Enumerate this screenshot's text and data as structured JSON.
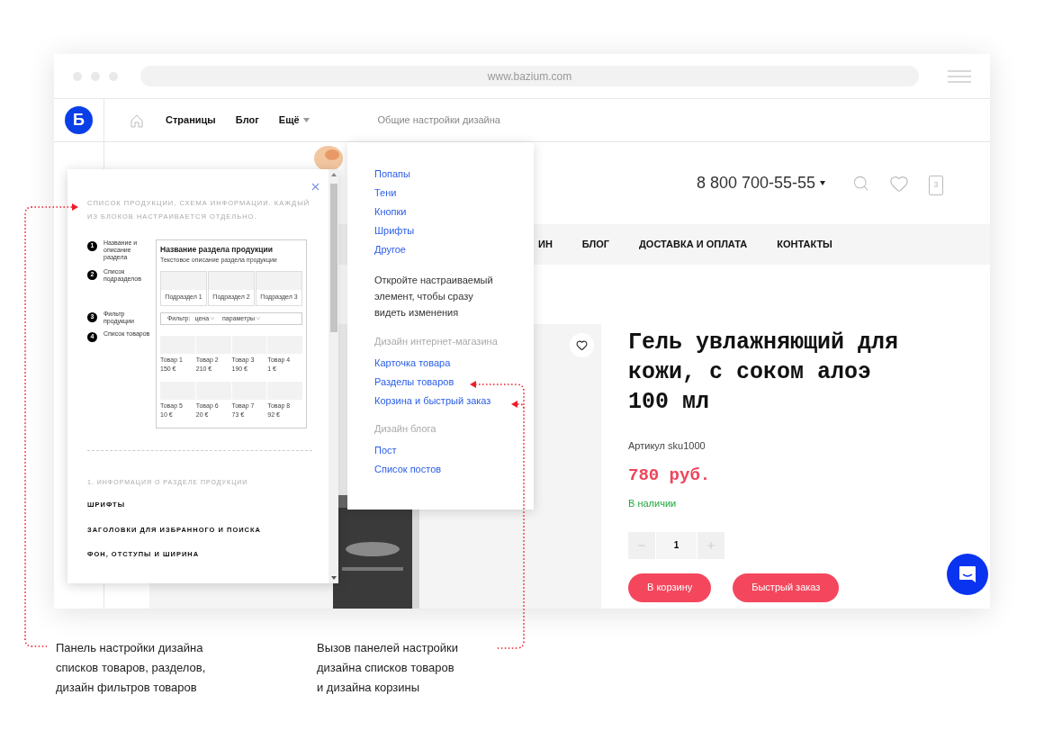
{
  "browser": {
    "url": "www.bazium.com"
  },
  "header": {
    "logo": "Б",
    "nav": [
      {
        "label": "Страницы",
        "caret": false
      },
      {
        "label": "Блог",
        "caret": false
      },
      {
        "label": "Ещё",
        "caret": true
      }
    ],
    "design_settings": "Общие настройки дизайна"
  },
  "store": {
    "phone": "8 800 700-55-55",
    "cart_count": "3",
    "menu": [
      "ИН",
      "БЛОГ",
      "ДОСТАВКА И ОПЛАТА",
      "КОНТАКТЫ"
    ]
  },
  "product": {
    "title": "Гель увлажняющий для кожи, с соком алоэ 100 мл",
    "sku": "Артикул sku1000",
    "price": "780 руб.",
    "stock": "В наличии",
    "quantity": "1",
    "buttons": [
      "В корзину",
      "Быстрый заказ"
    ]
  },
  "dropdown": {
    "sections": [
      {
        "kind": "links",
        "items": [
          "Попапы",
          "Тени",
          "Кнопки",
          "Шрифты",
          "Другое"
        ]
      },
      {
        "kind": "note",
        "text": "Откройте настраиваемый элемент, чтобы сразу видеть изменения"
      },
      {
        "kind": "group",
        "heading": "Дизайн интернет-магазина",
        "items": [
          "Карточка товара",
          "Разделы товаров",
          "Корзина и быстрый заказ"
        ]
      },
      {
        "kind": "group",
        "heading": "Дизайн блога",
        "items": [
          "Пост",
          "Список постов"
        ]
      }
    ]
  },
  "panel": {
    "intro": "СПИСОК ПРОДУКЦИИ, СХЕМА ИНФОРМАЦИИ. КАЖДЫЙ ИЗ БЛОКОВ НАСТРАИВАЕТСЯ ОТДЕЛЬНО.",
    "legend": [
      {
        "number": "1",
        "label": "Название и описание раздела"
      },
      {
        "number": "2",
        "label": "Список подразделов"
      },
      {
        "number": "3",
        "label": "Фильтр продукции"
      },
      {
        "number": "4",
        "label": "Список товаров"
      }
    ],
    "preview": {
      "title": "Название раздела продукции",
      "description": "Текстовое описание раздела продукции",
      "subsections": [
        "Подраздел 1",
        "Подраздел 2",
        "Подраздел 3"
      ],
      "filter": {
        "label": "Фильтр:",
        "options": [
          "цена",
          "параметры"
        ]
      },
      "products": [
        {
          "name": "Товар 1",
          "price": "150 €"
        },
        {
          "name": "Товар 2",
          "price": "210 €"
        },
        {
          "name": "Товар 3",
          "price": "190 €"
        },
        {
          "name": "Товар 4",
          "price": "1 €"
        },
        {
          "name": "Товар 5",
          "price": "10 €"
        },
        {
          "name": "Товар 6",
          "price": "20 €"
        },
        {
          "name": "Товар 7",
          "price": "73 €"
        },
        {
          "name": "Товар 8",
          "price": "92 €"
        }
      ]
    },
    "section_heading": "1. ИНФОРМАЦИЯ О РАЗДЕЛЕ ПРОДУКЦИИ",
    "items": [
      "ШРИФТЫ",
      "ЗАГОЛОВКИ ДЛЯ ИЗБРАННОГО И ПОИСКА",
      "ФОН, ОТСТУПЫ И ШИРИНА"
    ]
  },
  "annotations": [
    {
      "lines": [
        "Панель настройки дизайна",
        "списков товаров, разделов,",
        "дизайн фильтров товаров"
      ]
    },
    {
      "lines": [
        "Вызов панелей настройки",
        "дизайна списков товаров",
        "и дизайна корзины"
      ]
    }
  ]
}
